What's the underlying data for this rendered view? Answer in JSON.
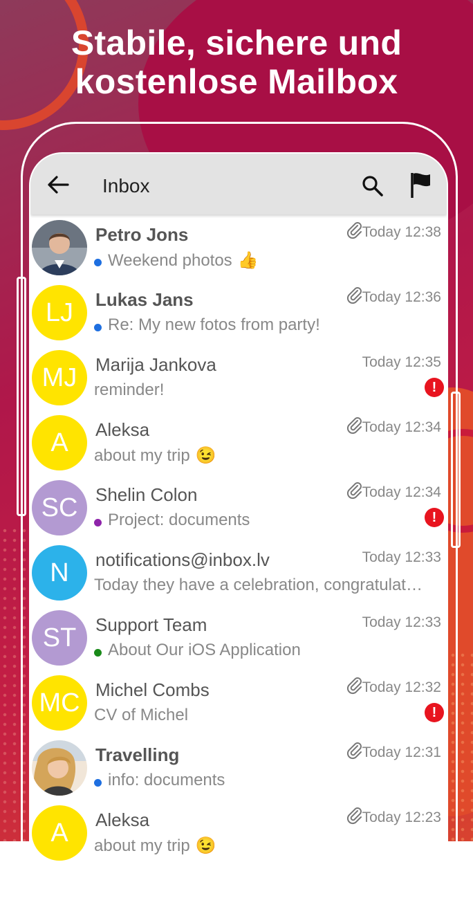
{
  "headline": {
    "line1": "Stabile, sichere und",
    "line2": "kostenlose Mailbox"
  },
  "appbar": {
    "title": "Inbox",
    "back_icon": "arrow-left-icon",
    "search_icon": "search-icon",
    "flag_icon": "flag-icon"
  },
  "colors": {
    "unread_dot_blue": "#1e6fe0",
    "purple": "#8e24aa",
    "green": "#1a8a1a",
    "alert_red": "#e8141f",
    "avatar_yellow": "#ffe400",
    "avatar_purple": "#b39ad2",
    "avatar_blue": "#2cb2ea"
  },
  "messages": [
    {
      "sender": "Petro Jons",
      "subject": "Weekend photos",
      "emoji": "👍",
      "time": "Today 12:38",
      "unread": true,
      "attachment": true,
      "dot": "blue",
      "avatar_initials": "",
      "avatar_type": "photo-man",
      "flagged": false
    },
    {
      "sender": "Lukas Jans",
      "subject": "Re: My new fotos from party!",
      "emoji": "",
      "time": "Today 12:36",
      "unread": true,
      "attachment": true,
      "dot": "blue",
      "avatar_initials": "LJ",
      "avatar_type": "yellow",
      "flagged": false
    },
    {
      "sender": "Marija Jankova",
      "subject": "reminder!",
      "emoji": "",
      "time": "Today 12:35",
      "unread": false,
      "attachment": false,
      "dot": "",
      "avatar_initials": "MJ",
      "avatar_type": "yellow",
      "flagged": true
    },
    {
      "sender": "Aleksa",
      "subject": "about my trip",
      "emoji": "😉",
      "time": "Today 12:34",
      "unread": false,
      "attachment": true,
      "dot": "",
      "avatar_initials": "A",
      "avatar_type": "yellow",
      "flagged": false
    },
    {
      "sender": "Shelin Colon",
      "subject": "Project: documents",
      "emoji": "",
      "time": "Today 12:34",
      "unread": false,
      "attachment": true,
      "dot": "purple",
      "avatar_initials": "SC",
      "avatar_type": "purple",
      "flagged": true
    },
    {
      "sender": "notifications@inbox.lv",
      "subject": "Today they have a celebration, congratulat…",
      "emoji": "",
      "time": "Today 12:33",
      "unread": false,
      "attachment": false,
      "dot": "",
      "avatar_initials": "N",
      "avatar_type": "blue",
      "flagged": false
    },
    {
      "sender": "Support Team",
      "subject": "About Our iOS Application",
      "emoji": "",
      "time": "Today 12:33",
      "unread": false,
      "attachment": false,
      "dot": "green",
      "avatar_initials": "ST",
      "avatar_type": "purple",
      "flagged": false
    },
    {
      "sender": "Michel Combs",
      "subject": "CV of Michel",
      "emoji": "",
      "time": "Today 12:32",
      "unread": false,
      "attachment": true,
      "dot": "",
      "avatar_initials": "MC",
      "avatar_type": "yellow",
      "flagged": true
    },
    {
      "sender": "Travelling",
      "subject": "info: documents",
      "emoji": "",
      "time": "Today 12:31",
      "unread": true,
      "attachment": true,
      "dot": "blue",
      "avatar_initials": "",
      "avatar_type": "photo-woman",
      "flagged": false
    },
    {
      "sender": "Aleksa",
      "subject": "about my trip",
      "emoji": "😉",
      "time": "Today 12:23",
      "unread": false,
      "attachment": true,
      "dot": "",
      "avatar_initials": "A",
      "avatar_type": "yellow",
      "flagged": false
    }
  ],
  "alert_symbol": "!"
}
